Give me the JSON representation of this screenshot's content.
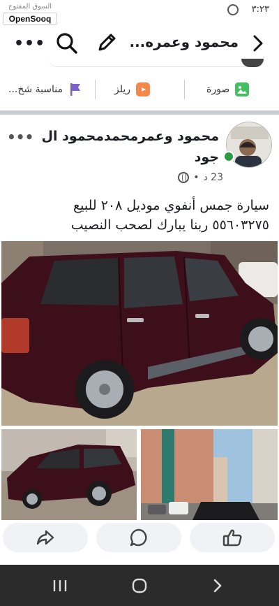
{
  "status_bar": {
    "time": "٣:٢٣",
    "icons": [
      "whatsapp-icon"
    ]
  },
  "watermark": {
    "arabic_text": "السوق المفتوح",
    "brand": "OpenSooq"
  },
  "app_bar": {
    "title": "محمود وعمره...",
    "icons": [
      "chevron-right-icon",
      "pencil-icon",
      "search-icon",
      "more-icon"
    ],
    "more_label": "•••"
  },
  "composer": {
    "actions": [
      {
        "label": "صورة",
        "icon": "photo-icon",
        "color": "#45bd62"
      },
      {
        "label": "ريلز",
        "icon": "reels-icon",
        "color": "#f3884a"
      },
      {
        "label": "مناسبة شخ...",
        "icon": "flag-icon",
        "color": "#7b61c9"
      }
    ]
  },
  "post": {
    "author": "محمود وعمرمحمدمحمود ال جود",
    "time": "23 د",
    "dot": "•",
    "privacy_icon": "globe-icon",
    "more_label": "•••",
    "text_line1": "سيارة جمس أنفوي موديل ٢٠٨ للبيع",
    "text_line2": "٥٥٦٠٣٢٧٥ ربنا يبارك لصحب النصيب",
    "images": [
      "main-car-photo",
      "car-side-photo",
      "building-street-photo"
    ]
  },
  "reactions": {
    "icons": [
      "share-icon",
      "comment-icon",
      "like-icon"
    ]
  },
  "nav": {
    "icons": [
      "recents-icon",
      "home-icon",
      "back-icon"
    ]
  },
  "colors": {
    "online": "#2e9b45",
    "divider": "#c9ccd1",
    "car": "#3d0f1a",
    "navbar": "#2b2b2b"
  }
}
